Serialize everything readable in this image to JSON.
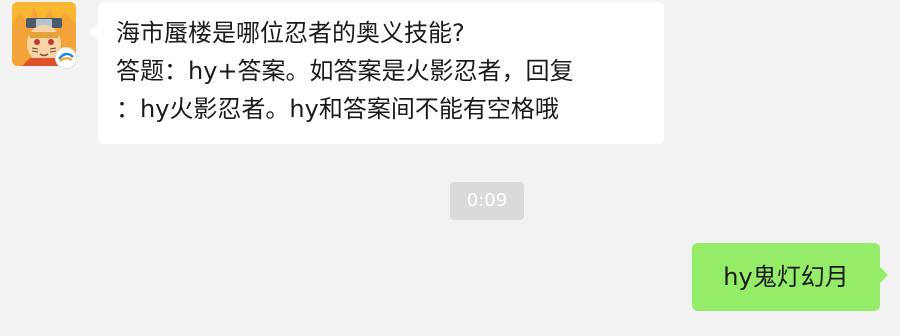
{
  "chat": {
    "incoming": {
      "sender_avatar_icon": "ninja-avatar-icon",
      "badge_icon": "game-badge-icon",
      "lines": [
        "海市蜃楼是哪位忍者的奥义技能?",
        "答题：hy+答案。如答案是火影忍者，回复",
        "：hy火影忍者。hy和答案间不能有空格哦"
      ]
    },
    "timestamp": "0:09",
    "outgoing": {
      "text": "hy鬼灯幻月"
    }
  },
  "colors": {
    "background": "#f2f2f2",
    "incoming_bubble": "#ffffff",
    "outgoing_bubble": "#95ec69",
    "timestamp_bg": "#dadada"
  }
}
